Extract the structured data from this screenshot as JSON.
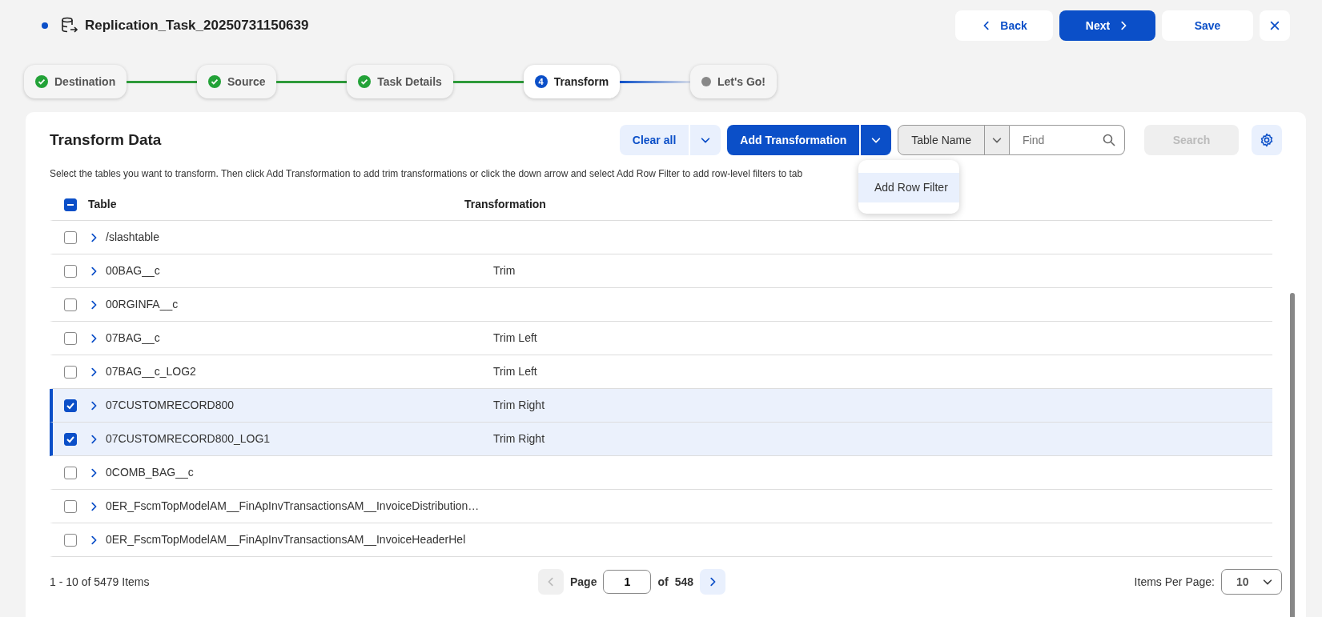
{
  "header": {
    "title": "Replication_Task_20250731150639",
    "buttons": [
      {
        "kind": "back",
        "label": "Back"
      },
      {
        "kind": "next",
        "label": "Next"
      },
      {
        "kind": "save",
        "label": "Save"
      },
      {
        "kind": "close"
      }
    ]
  },
  "steps": [
    {
      "label": "Destination",
      "completed": true,
      "selected": false
    },
    {
      "label": "Source",
      "completed": true,
      "selected": false
    },
    {
      "label": "Task Details",
      "completed": true,
      "selected": false
    },
    {
      "label": "Transform",
      "completed": false,
      "selected": true,
      "number": "4"
    },
    {
      "label": "Let's Go!",
      "completed": false,
      "selected": false
    }
  ],
  "panel": {
    "title": "Transform Data",
    "clear_button": "Clear all",
    "add_button": "Add Transformation",
    "filter_field": "Table Name",
    "find_placeholder": "Find",
    "search_button": "Search",
    "search_disabled": true,
    "dropdown_items": [
      {
        "label": "Add Row Filter",
        "selected": true
      }
    ],
    "description": "Select the tables you want to transform. Then click Add Transformation to add trim transformations or click the down arrow and select Add Row Filter to add row-level filters to tab"
  },
  "table": {
    "select_all_checked": true,
    "select_all_indeterminate": true,
    "columns": [
      "Table",
      "Transformation"
    ],
    "rows": [
      {
        "name": "/slashtable",
        "selected": false
      },
      {
        "name": "00BAG__c",
        "transformation": "Trim",
        "selected": false
      },
      {
        "name": "00RGINFA__c",
        "selected": false
      },
      {
        "name": "07BAG__c",
        "transformation": "Trim Left",
        "selected": false
      },
      {
        "name": "07BAG__c_LOG2",
        "transformation": "Trim Left",
        "selected": false
      },
      {
        "name": "07CUSTOMRECORD800",
        "transformation": "Trim Right",
        "selected": true
      },
      {
        "name": "07CUSTOMRECORD800_LOG1",
        "transformation": "Trim Right",
        "selected": true
      },
      {
        "name": "0COMB_BAG__c",
        "selected": false
      },
      {
        "name": "0ER_FscmTopModelAM__FinApInvTransactionsAM__InvoiceDistribution…",
        "selected": false
      },
      {
        "name": "0ER_FscmTopModelAM__FinApInvTransactionsAM__InvoiceHeaderHel",
        "selected": false
      }
    ]
  },
  "pagination": {
    "summary": "1 - 10 of 5479 Items",
    "page_label": "Page",
    "page": "1",
    "of_label": "of",
    "total": "548",
    "prev_disabled": true,
    "per_page_label": "Items Per Page:",
    "per_page": "10"
  }
}
